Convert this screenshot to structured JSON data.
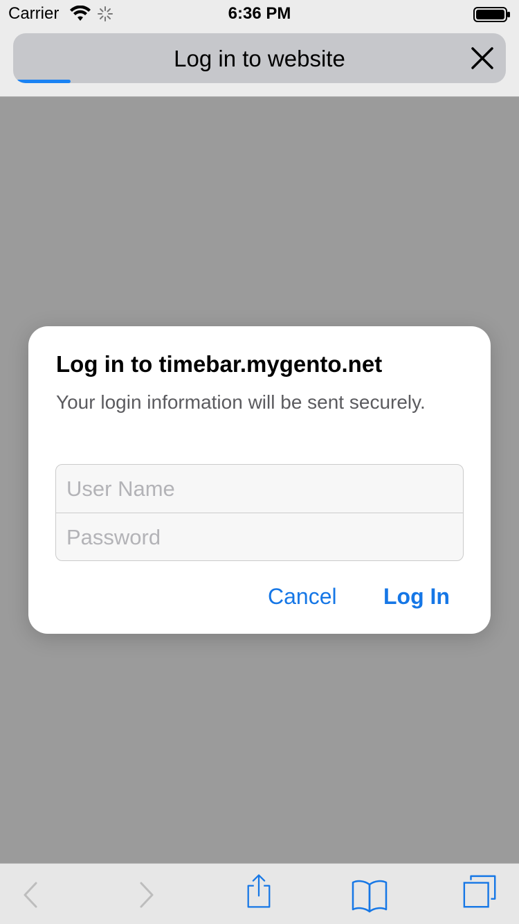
{
  "status_bar": {
    "carrier": "Carrier",
    "time": "6:36 PM"
  },
  "header": {
    "title": "Log in to website",
    "close_icon": "close-icon",
    "progress": 0.11,
    "accent_color": "#1a82f3"
  },
  "dialog": {
    "title": "Log in to timebar.mygento.net",
    "message": "Your login information will be sent securely.",
    "username_placeholder": "User Name",
    "username_value": "",
    "password_placeholder": "Password",
    "password_value": "",
    "cancel_label": "Cancel",
    "login_label": "Log In",
    "button_color": "#1677e6"
  },
  "toolbar": {
    "icons": [
      "back-icon",
      "forward-icon",
      "share-icon",
      "bookmarks-icon",
      "tabs-icon"
    ]
  }
}
